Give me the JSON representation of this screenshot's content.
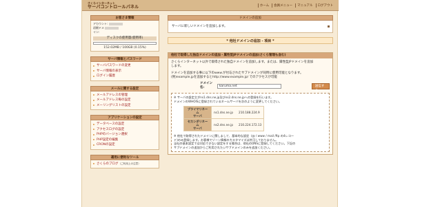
{
  "header": {
    "logo_small": "さくらインターネット",
    "logo_large": "サーバコントロールパネル",
    "nav": [
      "ホーム",
      "会員メニュー",
      "マニュアル",
      "ログアウト"
    ]
  },
  "sidebar": {
    "customer": {
      "title": "お客さま情報",
      "account_label": "アカウント:",
      "domain_label_1": "初期ドメ",
      "domain_label_2": "イン:",
      "disk_label": "ディスクの使用量(使用率)",
      "disk_value": "152.02MB / 100GB (0.15%)",
      "disk_fraction": 0.0015
    },
    "sections": [
      {
        "title": "サーバ情報とパスワード",
        "links": [
          {
            "label": "サーバパスワードの変更",
            "note": ""
          },
          {
            "label": "サーバ情報の表示",
            "note": ""
          },
          {
            "label": "ログイン履歴",
            "note": ""
          }
        ]
      },
      {
        "title": "メールに関する設定",
        "links": [
          {
            "label": "メールアドレスの管理",
            "note": ""
          },
          {
            "label": "メールアドレス毎の設定",
            "note": ""
          },
          {
            "label": "メーリングリストの設定",
            "note": ""
          }
        ]
      },
      {
        "title": "アプリケーションの設定",
        "links": [
          {
            "label": "データベースの設定",
            "note": ""
          },
          {
            "label": "アクセスログの設定",
            "note": ""
          },
          {
            "label": "PHPのバージョン選択",
            "note": ""
          },
          {
            "label": "PHP設定の編集",
            "note": ""
          },
          {
            "label": "CRONの設定",
            "note": ""
          }
        ]
      },
      {
        "title": "運用に便利なツール",
        "links": [
          {
            "label": "さくらのブログ",
            "note": "（ご利用上の注意）"
          }
        ]
      }
    ]
  },
  "main": {
    "title": "ドメインの追加",
    "message": "サーバに新しいドメインを追加します。",
    "step": "* 他社ドメインの追加 - 項目 *",
    "panel": {
      "title": "他社で取得した独自ドメインの追加・属性型JPドメインの追加(さくら管理も含む)",
      "intro_1": "さくらインターネット以外で取得された独自ドメインを追加します。または、属性型JPドメインを追加",
      "intro_2": "します。",
      "note_1": "ドメインを追加する事に以下のwww.が付与されたサブドメインが同時に使用可能となります。",
      "note_2": "(例)example.jpを追加するとhttp://www.example.jp/ でのアクセスが可能",
      "domain_label": "ドメイン名:",
      "domain_value": "karuma.net",
      "submit_label": "送信する",
      "info_1": "※ サーバの設定主がns1.dns.ne.jp及びns2.dns.ne.jpへの登録を行います。",
      "info_2": "ドメインのWHOISに登録されているネームサーバを次のように変更してください。",
      "ns": [
        {
          "label_1": "プライマリネーム",
          "label_2": "サーバ",
          "host": "ns1.dns.ne.jp",
          "ip": "210.188.224.9"
        },
        {
          "label_1": "セカンダリネーム",
          "label_2": "サーバ",
          "host": "ns2.dns.ne.jp",
          "ip": "210.224.172.13"
        }
      ],
      "info_3": "※ 他社で取得されたドメインに関しまして、基本的な設定（@ / www / mail /ftp の4レコー",
      "info_4": "ド)のみ登録します。お客様でゾーン情報のカスタマイズは許可しておりません。",
      "info_5": "当社の基本設定では対応できない設定をする場合は、他社のDNSに登録してください。下記の",
      "info_6": "サブドメインの追加からご利用されたいサブドメインのみを追加ください。"
    }
  },
  "colors": {
    "header_bg": "#d9b98c",
    "section_head": "#d7a77b",
    "link": "#a02020",
    "page_bg": "#f7ebd6"
  }
}
